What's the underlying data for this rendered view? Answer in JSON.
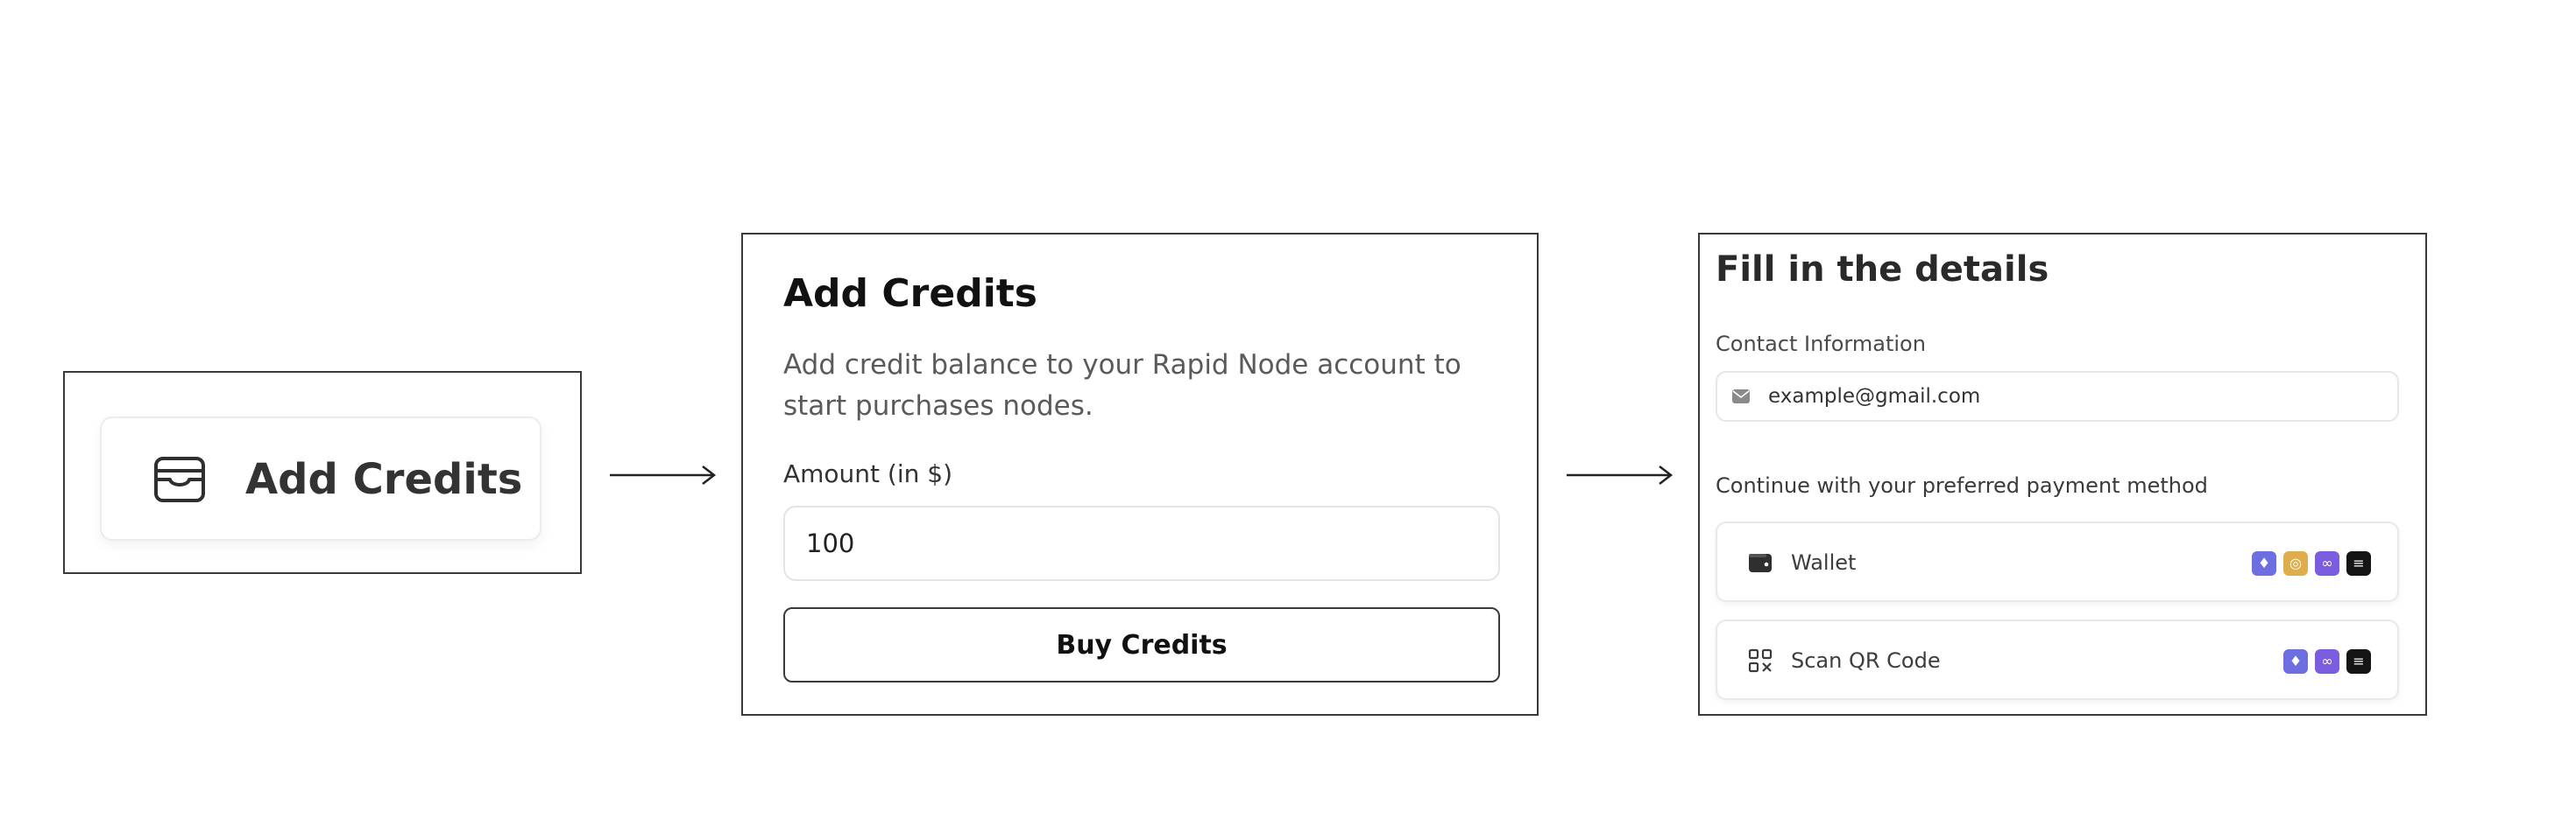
{
  "step1": {
    "button_label": "Add Credits"
  },
  "step2": {
    "title": "Add Credits",
    "description": "Add credit balance to your Rapid Node account to start purchases nodes.",
    "amount_label": "Amount (in $)",
    "amount_value": "100",
    "buy_button_label": "Buy Credits"
  },
  "step3": {
    "title": "Fill in the details",
    "contact_label": "Contact Information",
    "email_value": "example@gmail.com",
    "payment_prompt": "Continue with your preferred payment method",
    "options": [
      {
        "label": "Wallet",
        "icon": "wallet-icon",
        "chips": [
          {
            "name": "ethereum-chip-icon",
            "color": "#6d6fe0",
            "glyph": "♦"
          },
          {
            "name": "bitcoin-chip-icon",
            "color": "#e0ad4c",
            "glyph": "◎"
          },
          {
            "name": "chain-link-chip-icon",
            "color": "#7b5de0",
            "glyph": "∞"
          },
          {
            "name": "stack-chip-icon",
            "color": "#151515",
            "glyph": "≡"
          }
        ]
      },
      {
        "label": "Scan QR Code",
        "icon": "qr-code-icon",
        "chips": [
          {
            "name": "ethereum-chip-icon",
            "color": "#6d6fe0",
            "glyph": "♦"
          },
          {
            "name": "chain-link-chip-icon",
            "color": "#7b5de0",
            "glyph": "∞"
          },
          {
            "name": "stack-chip-icon",
            "color": "#151515",
            "glyph": "≡"
          }
        ]
      }
    ]
  }
}
